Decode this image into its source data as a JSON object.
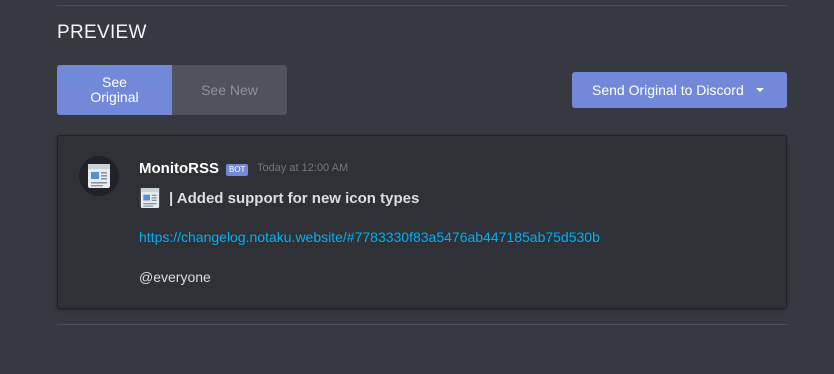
{
  "section": {
    "title": "PREVIEW"
  },
  "view_toggle": {
    "see_original": "See Original",
    "see_new": "See New",
    "active": "see_original"
  },
  "send_button": {
    "label": "Send Original to Discord",
    "icon": "caret-down-icon"
  },
  "message": {
    "username": "MonitoRSS",
    "badge": "BOT",
    "timestamp": "Today at 12:00 AM",
    "avatar_icon": "newspaper-icon",
    "title_icon": "newspaper-icon",
    "title_text": "| Added support for new icon types",
    "link": "https://changelog.notaku.website/#7783330f83a5476ab447185ab75d530b",
    "mention": "@everyone"
  },
  "colors": {
    "background": "#36393f",
    "card": "#2f3136",
    "accent": "#7289da",
    "link": "#00b0f4"
  }
}
